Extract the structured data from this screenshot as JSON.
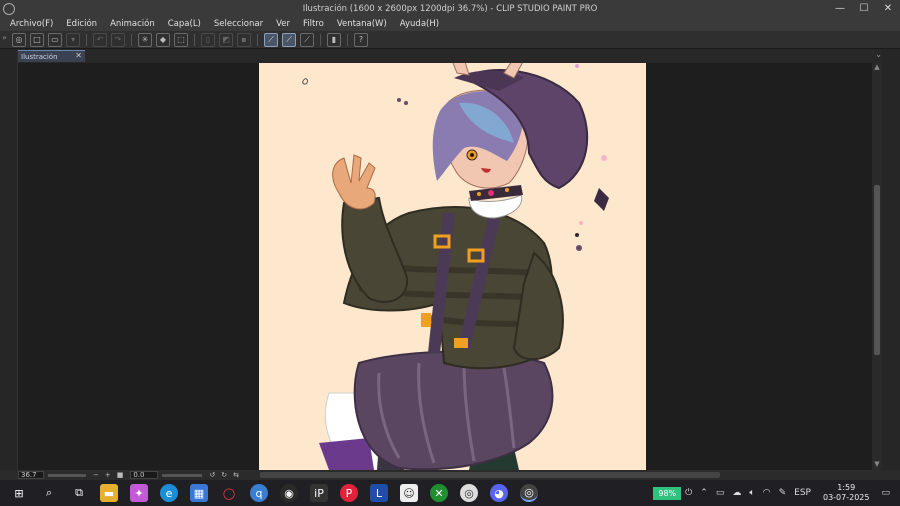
{
  "window": {
    "title": "Ilustración (1600 x 2600px 1200dpi 36.7%) - CLIP STUDIO PAINT PRO",
    "minimize": "—",
    "maximize": "☐",
    "close": "✕"
  },
  "menu": [
    "Archivo(F)",
    "Edición",
    "Animación",
    "Capa(L)",
    "Seleccionar",
    "Ver",
    "Filtro",
    "Ventana(W)",
    "Ayuda(H)"
  ],
  "tab": {
    "label": "Ilustración",
    "close": "✕"
  },
  "status": {
    "zoom": "36.7",
    "angle": "0.0"
  },
  "taskbar": {
    "battery": "98%",
    "language": "ESP",
    "time": "1:59",
    "date": "03-07-2025"
  },
  "colors": {
    "page": "#fde8cd",
    "accent": "#6b86b0",
    "battery": "#2ec27e"
  }
}
